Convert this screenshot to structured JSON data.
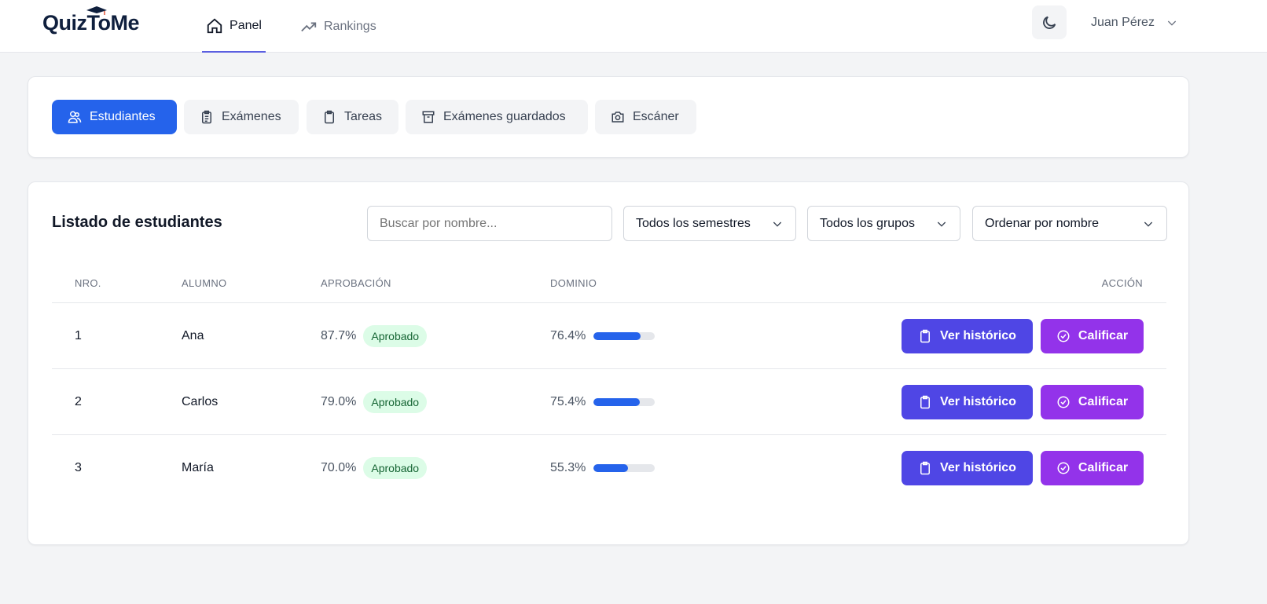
{
  "app": {
    "logo": "QuizToMe"
  },
  "nav": {
    "panel": "Panel",
    "rankings": "Rankings"
  },
  "user": {
    "name": "Juan Pérez"
  },
  "tabs": [
    {
      "label": "Estudiantes",
      "icon": "users-icon"
    },
    {
      "label": "Exámenes",
      "icon": "clipboard-list-icon"
    },
    {
      "label": "Tareas",
      "icon": "clipboard-icon"
    },
    {
      "label": "Exámenes guardados",
      "icon": "archive-icon"
    },
    {
      "label": "Escáner",
      "icon": "camera-icon"
    }
  ],
  "list": {
    "title": "Listado de estudiantes",
    "search_placeholder": "Buscar por nombre...",
    "semester": "Todos los semestres",
    "group": "Todos los grupos",
    "sort": "Ordenar por nombre",
    "headers": {
      "nro": "NRO.",
      "alumno": "ALUMNO",
      "aprobacion": "APROBACIÓN",
      "dominio": "DOMINIO",
      "accion": "ACCIÓN"
    },
    "rows": [
      {
        "nro": "1",
        "name": "Ana",
        "approval": "87.7%",
        "status": "Aprobado",
        "mastery": "76.4%",
        "mastery_value": 76.4
      },
      {
        "nro": "2",
        "name": "Carlos",
        "approval": "79.0%",
        "status": "Aprobado",
        "mastery": "75.4%",
        "mastery_value": 75.4
      },
      {
        "nro": "3",
        "name": "María",
        "approval": "70.0%",
        "status": "Aprobado",
        "mastery": "55.3%",
        "mastery_value": 55.3
      }
    ],
    "history_label": "Ver histórico",
    "grade_label": "Calificar"
  },
  "colors": {
    "primary": "#2563eb",
    "history": "#4f46e5",
    "grade": "#9333ea",
    "badge_bg": "#dcfce7"
  }
}
